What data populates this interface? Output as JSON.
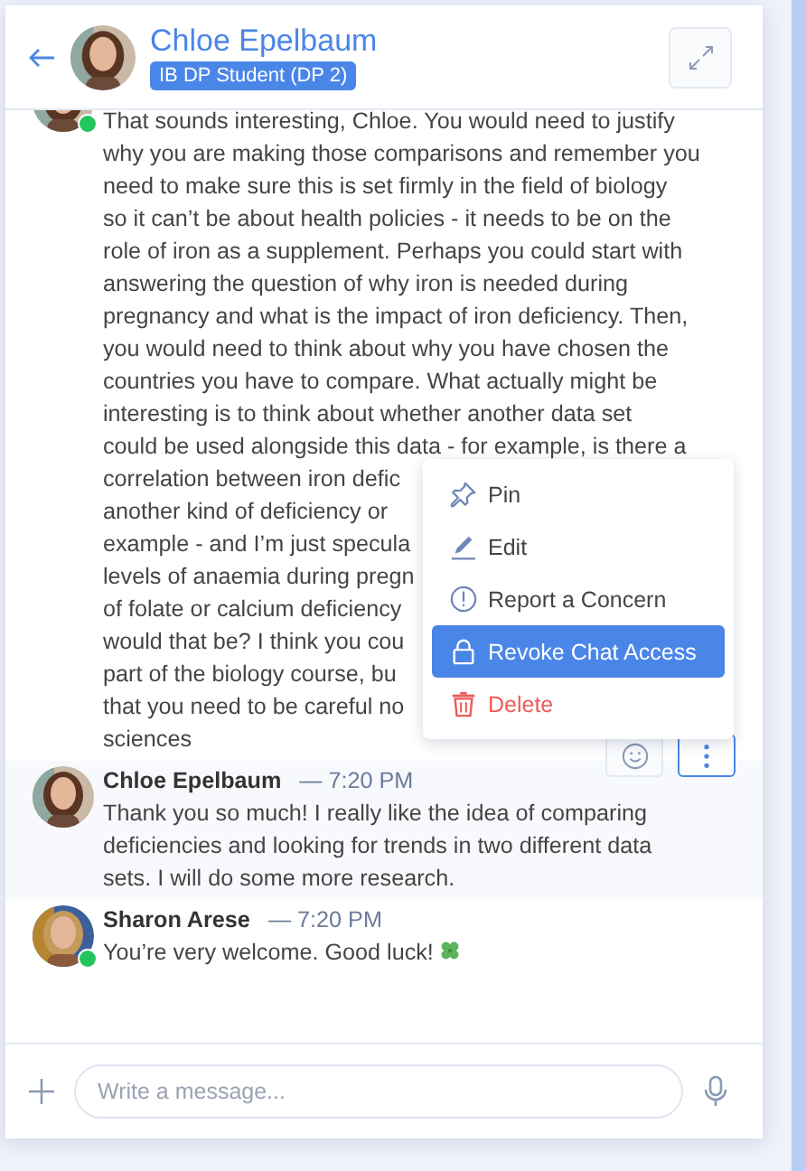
{
  "header": {
    "name": "Chloe Epelbaum",
    "badge": "IB DP Student (DP 2)"
  },
  "messages": [
    {
      "online": true,
      "highlighted": false,
      "lines": [
        "That sounds interesting, Chloe. You would need to justify",
        "why you are making those comparisons and remember you",
        "need to make sure this is set firmly in the field of biology",
        "so it can’t be about health policies - it needs to be on the",
        "role of iron as a supplement. Perhaps you could start with",
        "answering the question of why iron is needed during",
        "pregnancy and what is the impact of iron deficiency. Then,",
        "you would need to think about why you have chosen the",
        "countries you have to compare. What actually might be",
        "interesting is to think about whether another data set",
        "could be used alongside this data - for example, is there a",
        "correlation between iron defic",
        "another kind of deficiency or",
        "example - and I’m just specula",
        "levels of anaemia during pregn",
        "of folate or calcium deficiency",
        "would that be? I think you cou",
        "part of the biology course, bu",
        "that you need to be careful no",
        "sciences"
      ]
    },
    {
      "author": "Chloe Epelbaum",
      "time": "— 7:20 PM",
      "online": false,
      "highlighted": true,
      "text": "Thank you so much! I really like the idea of comparing deficiencies and looking for trends in two different data sets. I will do some more research.",
      "actions": [
        {
          "kind": "emoji",
          "selected": false
        },
        {
          "kind": "more",
          "selected": true
        }
      ]
    },
    {
      "author": "Sharon Arese",
      "time": "— 7:20 PM",
      "online": true,
      "highlighted": false,
      "text": "You’re very welcome. Good luck!",
      "trailing": {
        "kind": "clover"
      }
    }
  ],
  "context_menu": [
    {
      "kind": "pin",
      "label": "Pin",
      "selected": false
    },
    {
      "kind": "edit",
      "label": "Edit",
      "selected": false
    },
    {
      "kind": "report",
      "label": "Report a Concern",
      "selected": false
    },
    {
      "kind": "revoke",
      "label": "Revoke Chat Access",
      "selected": true
    },
    {
      "kind": "delete",
      "label": "Delete",
      "selected": false
    }
  ],
  "composer": {
    "placeholder": "Write a message..."
  }
}
